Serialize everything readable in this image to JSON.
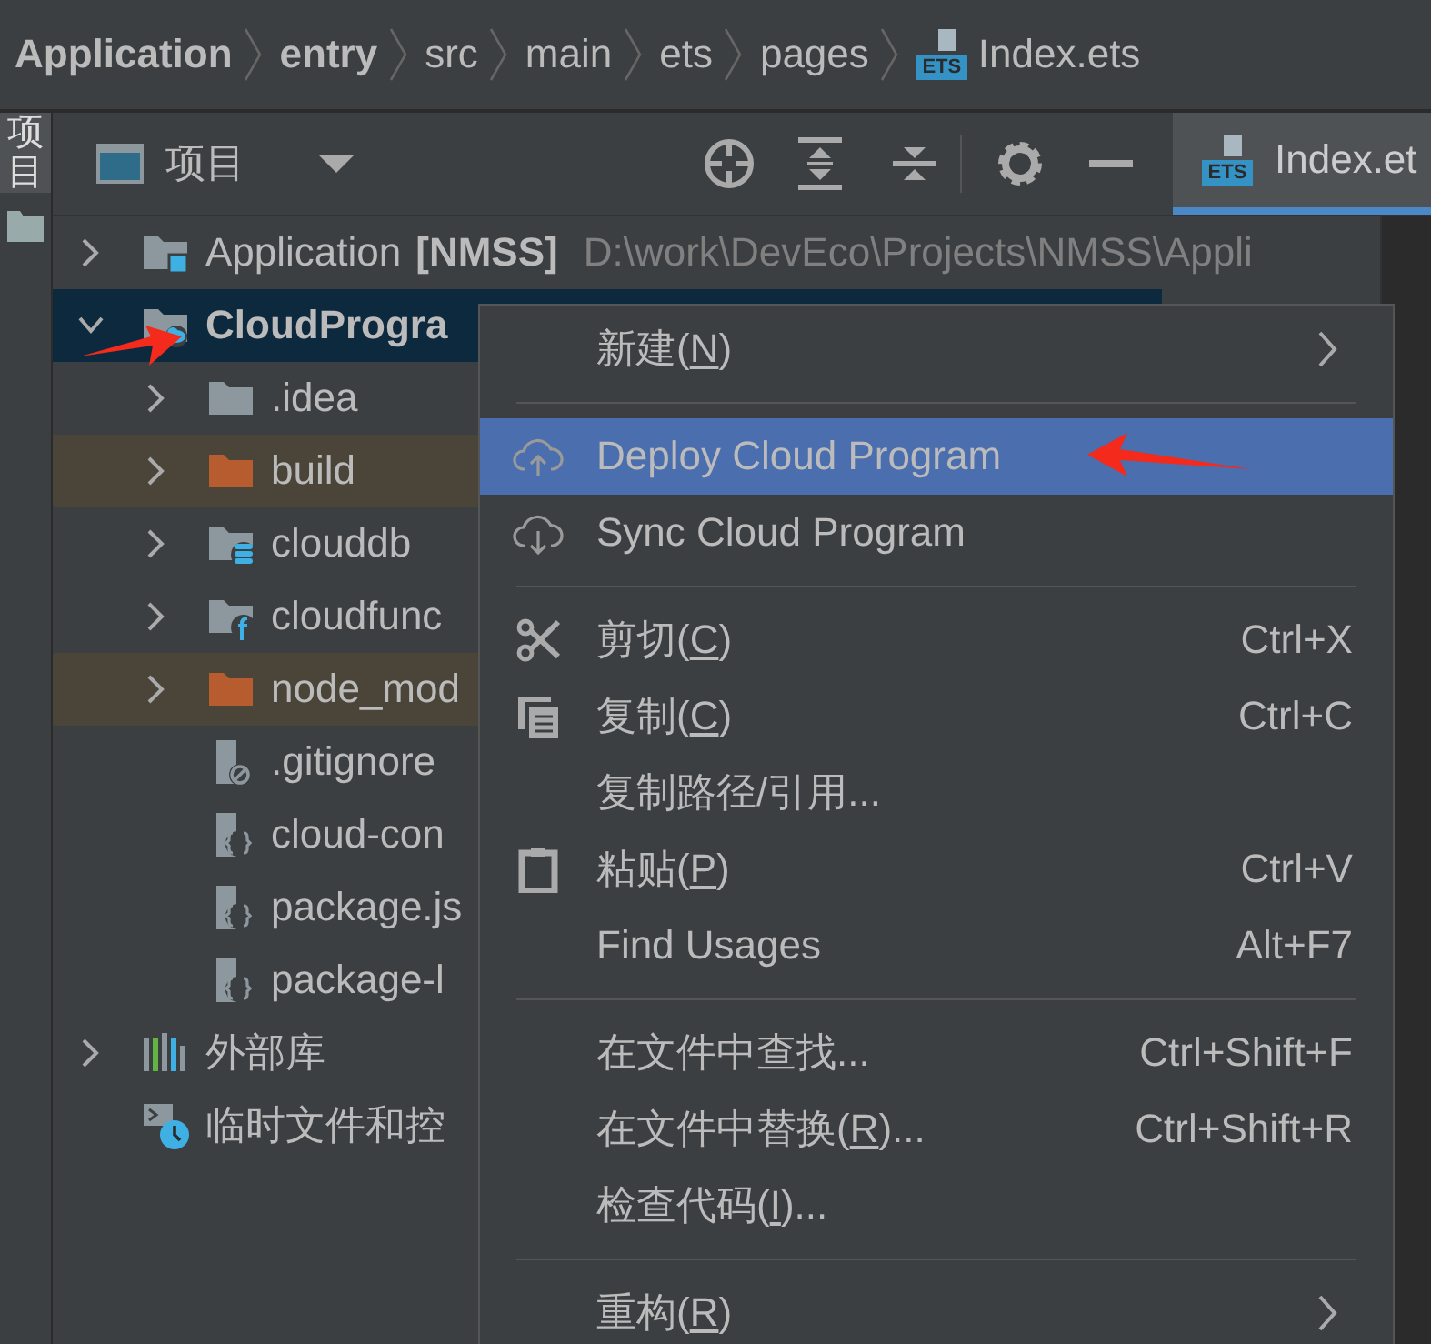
{
  "breadcrumb": [
    {
      "label": "Application",
      "kind": "module"
    },
    {
      "label": "entry",
      "kind": "module"
    },
    {
      "label": "src",
      "kind": "dir"
    },
    {
      "label": "main",
      "kind": "dir"
    },
    {
      "label": "ets",
      "kind": "dir"
    },
    {
      "label": "pages",
      "kind": "dir"
    },
    {
      "label": "Index.ets",
      "kind": "file",
      "badge": "ETS"
    }
  ],
  "side_tabs": [
    {
      "label": "项目",
      "selected": true
    }
  ],
  "toolbar": {
    "view": "项目"
  },
  "editor_tab": {
    "label": "Index.et",
    "badge": "ETS",
    "selected": true
  },
  "tree": [
    {
      "label": "Application",
      "tag": "[NMSS]",
      "path": "D:\\work\\DevEco\\Projects\\NMSS\\Appli",
      "kind": "module",
      "expanded": false,
      "selected": false
    },
    {
      "label": "CloudProgra",
      "kind": "cloud-module",
      "expanded": true,
      "selected": true,
      "arrow": true,
      "children": [
        {
          "label": ".idea",
          "kind": "folder",
          "expanded": false,
          "selected": false
        },
        {
          "label": "build",
          "kind": "excluded-folder",
          "expanded": false,
          "selected": false
        },
        {
          "label": "clouddb",
          "kind": "db-folder",
          "expanded": false,
          "selected": false
        },
        {
          "label": "cloudfunc",
          "kind": "func-folder",
          "expanded": false,
          "selected": false
        },
        {
          "label": "node_mod",
          "kind": "excluded-folder",
          "expanded": false,
          "selected": false
        },
        {
          "label": ".gitignore",
          "kind": "ignore-file",
          "selected": false
        },
        {
          "label": "cloud-con",
          "kind": "json-file",
          "selected": false
        },
        {
          "label": "package.js",
          "kind": "json-file",
          "selected": false
        },
        {
          "label": "package-l",
          "kind": "json-file",
          "selected": false
        }
      ]
    },
    {
      "label": "外部库",
      "kind": "libraries",
      "expanded": false,
      "selected": false
    },
    {
      "label": "临时文件和控",
      "kind": "scratches",
      "selected": false
    }
  ],
  "menu": [
    {
      "kind": "plain",
      "label": "新建(",
      "mnemonic": "N",
      "label_end": ")",
      "submenu": true,
      "selected": false
    },
    {
      "kind": "separator"
    },
    {
      "kind": "upload",
      "label": "Deploy Cloud Program",
      "selected": true,
      "arrow": true
    },
    {
      "kind": "download",
      "label": "Sync Cloud Program",
      "selected": false
    },
    {
      "kind": "separator"
    },
    {
      "kind": "cut",
      "label": "剪切(",
      "mnemonic": "C",
      "label_end": ")",
      "shortcut": "Ctrl+X",
      "selected": false
    },
    {
      "kind": "copy",
      "label": "复制(",
      "mnemonic": "C",
      "label_end": ")",
      "shortcut": "Ctrl+C",
      "selected": false
    },
    {
      "kind": "plain",
      "label": "复制路径/引用...",
      "selected": false
    },
    {
      "kind": "paste",
      "label": "粘贴(",
      "mnemonic": "P",
      "label_end": ")",
      "shortcut": "Ctrl+V",
      "selected": false
    },
    {
      "kind": "plain",
      "label": "Find Usages",
      "shortcut": "Alt+F7",
      "selected": false
    },
    {
      "kind": "separator"
    },
    {
      "kind": "plain",
      "label": "在文件中查找...",
      "shortcut": "Ctrl+Shift+F",
      "selected": false
    },
    {
      "kind": "plain",
      "label": "在文件中替换(",
      "mnemonic": "R",
      "label_end": ")...",
      "shortcut": "Ctrl+Shift+R",
      "selected": false
    },
    {
      "kind": "plain",
      "label": "检查代码(",
      "mnemonic": "I",
      "label_end": ")...",
      "selected": false
    },
    {
      "kind": "separator"
    },
    {
      "kind": "plain",
      "label": "重构(",
      "mnemonic": "R",
      "label_end": ")",
      "submenu": true,
      "selected": false
    }
  ]
}
